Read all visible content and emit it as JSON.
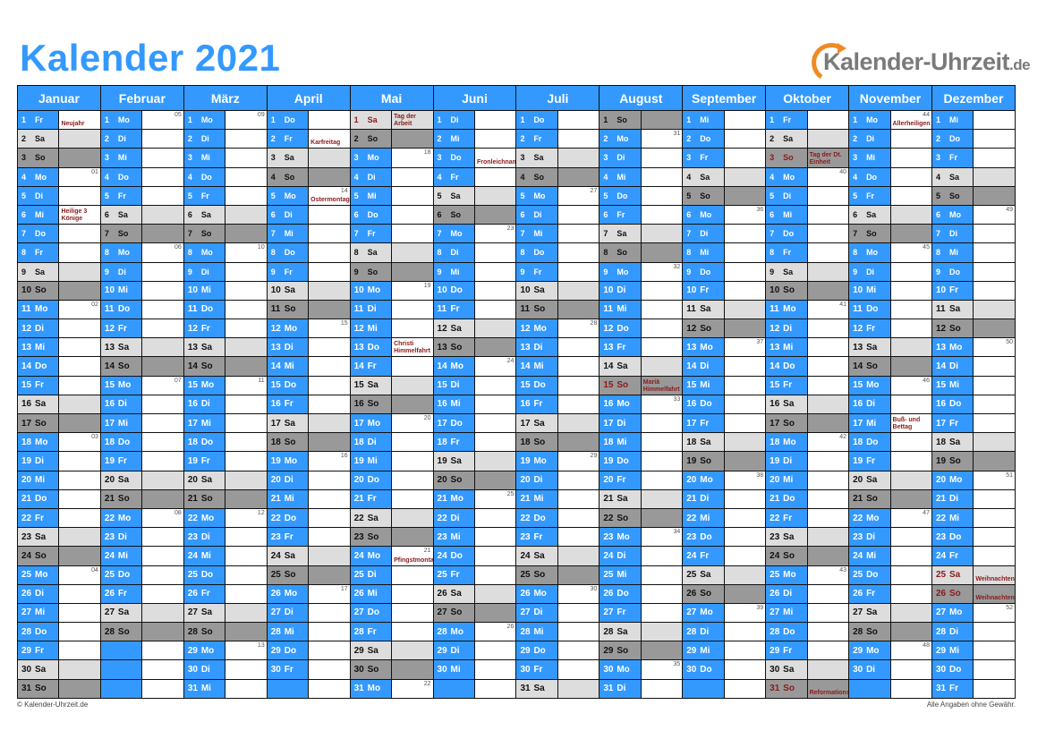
{
  "title": "Kalender 2021",
  "logo": {
    "name": "Kalender-Uhrzeit",
    "tld": ".de"
  },
  "colors": {
    "accent": "#3399ff",
    "saturday": "#dddddd",
    "sunday": "#999999",
    "holiday": "#8b1a1a"
  },
  "months": [
    {
      "name": "Januar",
      "days": 31,
      "start": 5
    },
    {
      "name": "Februar",
      "days": 28,
      "start": 1
    },
    {
      "name": "März",
      "days": 31,
      "start": 1
    },
    {
      "name": "April",
      "days": 30,
      "start": 4
    },
    {
      "name": "Mai",
      "days": 31,
      "start": 6
    },
    {
      "name": "Juni",
      "days": 30,
      "start": 2
    },
    {
      "name": "Juli",
      "days": 31,
      "start": 4
    },
    {
      "name": "August",
      "days": 31,
      "start": 0
    },
    {
      "name": "September",
      "days": 30,
      "start": 3
    },
    {
      "name": "Oktober",
      "days": 31,
      "start": 5
    },
    {
      "name": "November",
      "days": 30,
      "start": 1
    },
    {
      "name": "Dezember",
      "days": 31,
      "start": 3
    }
  ],
  "weekdays": [
    "So",
    "Mo",
    "Di",
    "Mi",
    "Do",
    "Fr",
    "Sa"
  ],
  "holidays": [
    {
      "month": 0,
      "day": 1,
      "label": "Neujahr"
    },
    {
      "month": 0,
      "day": 6,
      "label": "Heilige 3 Könige"
    },
    {
      "month": 3,
      "day": 2,
      "label": "Karfreitag"
    },
    {
      "month": 3,
      "day": 5,
      "label": "Ostermontag"
    },
    {
      "month": 4,
      "day": 1,
      "label": "Tag der Arbeit",
      "red": true
    },
    {
      "month": 4,
      "day": 13,
      "label": "Christi Himmelfahrt"
    },
    {
      "month": 4,
      "day": 24,
      "label": "Pfingstmontag"
    },
    {
      "month": 5,
      "day": 3,
      "label": "Fronleichnam"
    },
    {
      "month": 7,
      "day": 15,
      "label": "Mariä Himmelfahrt",
      "red": true
    },
    {
      "month": 9,
      "day": 3,
      "label": "Tag der Dt. Einheit",
      "red": true
    },
    {
      "month": 9,
      "day": 31,
      "label": "Reformationstag",
      "red": true
    },
    {
      "month": 10,
      "day": 1,
      "label": "Allerheiligen"
    },
    {
      "month": 10,
      "day": 17,
      "label": "Buß- und Bettag"
    },
    {
      "month": 11,
      "day": 25,
      "label": "Weihnachten",
      "red": true
    },
    {
      "month": 11,
      "day": 26,
      "label": "Weihnachten",
      "red": true
    }
  ],
  "footer": {
    "left": "© Kalender-Uhrzeit.de",
    "right": "Alle Angaben ohne Gewähr."
  }
}
